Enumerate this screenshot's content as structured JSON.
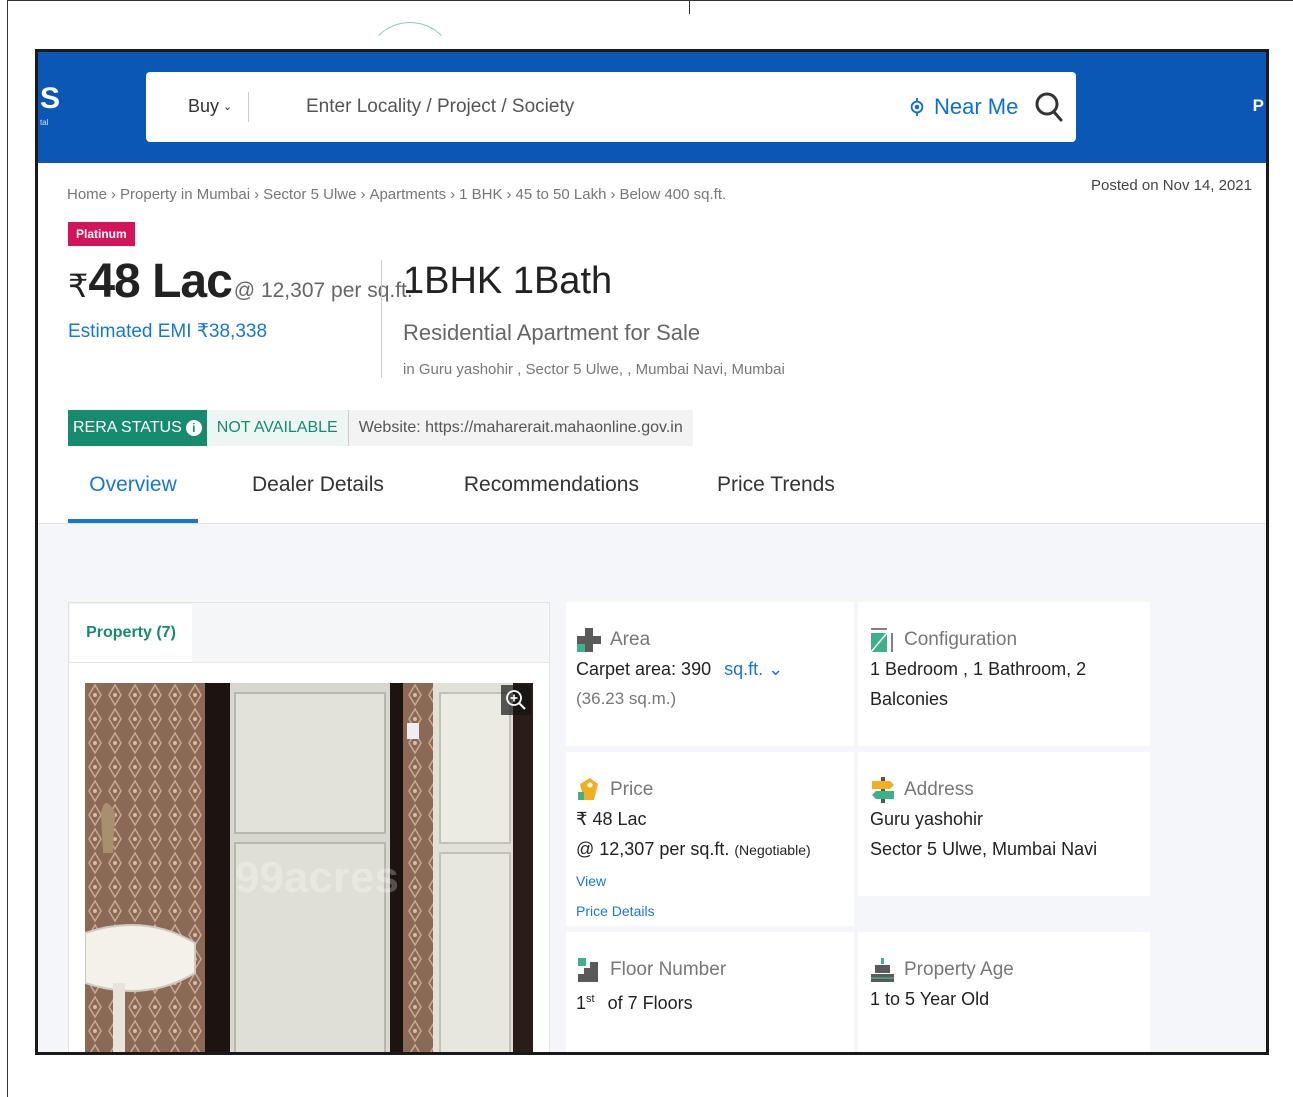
{
  "header": {
    "logo_fragment": "S",
    "right_fragment": "P",
    "search": {
      "buy_label": "Buy",
      "placeholder": "Enter Locality / Project / Society",
      "near_me": "Near Me"
    }
  },
  "breadcrumb": [
    "Home",
    "Property in Mumbai",
    "Sector 5 Ulwe",
    "Apartments",
    "1 BHK",
    "45 to 50 Lakh",
    "Below 400 sq.ft."
  ],
  "posted_on": "Posted on Nov 14, 2021",
  "badge": "Platinum",
  "price": {
    "currency": "₹",
    "value": "48 Lac",
    "per_sqft": "@ 12,307 per sq.ft.",
    "emi": "Estimated EMI ₹38,338"
  },
  "listing": {
    "title": "1BHK 1Bath",
    "subtitle": "Residential Apartment for Sale",
    "location": "in Guru yashohir , Sector 5 Ulwe, , Mumbai Navi, Mumbai"
  },
  "rera": {
    "status_label": "RERA STATUS",
    "status_value": "NOT AVAILABLE",
    "website": "Website: https://maharerait.mahaonline.gov.in"
  },
  "tabs": [
    "Overview",
    "Dealer Details",
    "Recommendations",
    "Price Trends"
  ],
  "gallery": {
    "tab_label": "Property (7)",
    "watermark": "99acres"
  },
  "details": {
    "area": {
      "label": "Area",
      "carpet": "Carpet area: 390",
      "unit": "sq.ft.",
      "alt": "(36.23 sq.m.)"
    },
    "configuration": {
      "label": "Configuration",
      "line1": "1 Bedroom , 1 Bathroom, 2",
      "line2": "Balconies"
    },
    "price": {
      "label": "Price",
      "line1": "₹ 48 Lac",
      "line2": "@ 12,307 per sq.ft.",
      "negotiable": "(Negotiable)",
      "view": "View",
      "price_details": "Price Details"
    },
    "address": {
      "label": "Address",
      "line1": "Guru yashohir",
      "line2": "Sector 5 Ulwe, Mumbai Navi"
    },
    "floor": {
      "label": "Floor Number",
      "floor_no": "1",
      "floor_suffix": "st",
      "of_floors": "of 7 Floors"
    },
    "age": {
      "label": "Property Age",
      "value": "1 to 5 Year Old"
    }
  },
  "colors": {
    "header_blue": "#0b57b5",
    "link_blue": "#1777d4",
    "rera_green": "#178b6e",
    "platinum_pink": "#d4145a"
  }
}
